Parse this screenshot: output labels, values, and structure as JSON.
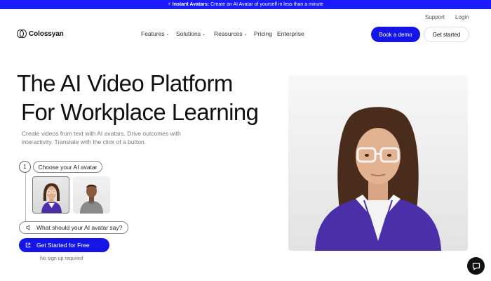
{
  "announcement": {
    "bold": "Instant Avatars:",
    "text": " Create an AI Avatar of yourself in less than a minute"
  },
  "utility": {
    "support": "Support",
    "login": "Login"
  },
  "brand": {
    "name": "Colossyan"
  },
  "nav": {
    "features": "Features",
    "solutions": "Solutions",
    "resources": "Resources",
    "pricing": "Pricing",
    "enterprise": "Enterprise"
  },
  "header": {
    "demo_label": "Book a demo",
    "start_label": "Get started"
  },
  "hero": {
    "title_line1": "The AI Video Platform",
    "title_line2": "For Workplace Learning",
    "subtitle": "Create videos from text with AI avatars. Drive outcomes with interactivity. Translate with the click of a button."
  },
  "steps": {
    "step1_number": "1",
    "step1_label": "Choose your AI avatar",
    "say_label": "What should your AI avatar say?"
  },
  "cta": {
    "label": "Get Started for Free",
    "note": "No sign up required"
  },
  "colors": {
    "brand_blue": "#1515e6",
    "announce_blue": "#1a1aff",
    "sweater": "#4a2fa8"
  },
  "icons": {
    "announcement": "lightning-icon",
    "nav_chevron": "chevron-down-icon",
    "say": "speaker-icon",
    "cta": "external-link-icon",
    "chat": "chat-icon"
  }
}
